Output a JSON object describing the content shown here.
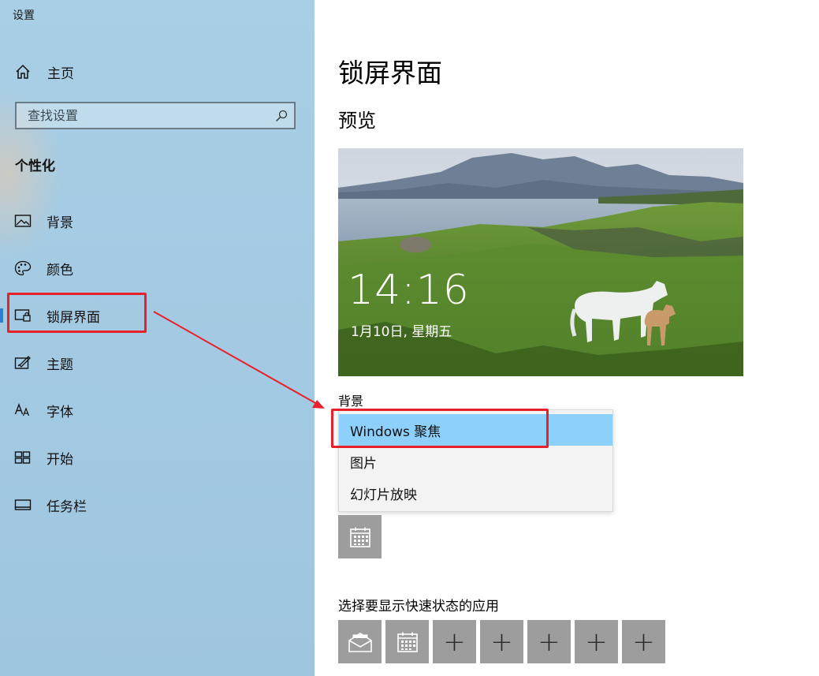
{
  "window": {
    "title": "设置"
  },
  "sidebar": {
    "home_label": "主页",
    "search_placeholder": "查找设置",
    "section_title": "个性化",
    "items": [
      {
        "label": "背景",
        "icon": "picture-icon"
      },
      {
        "label": "颜色",
        "icon": "palette-icon"
      },
      {
        "label": "锁屏界面",
        "icon": "lock-screen-icon",
        "active": true
      },
      {
        "label": "主题",
        "icon": "theme-icon"
      },
      {
        "label": "字体",
        "icon": "font-icon"
      },
      {
        "label": "开始",
        "icon": "start-icon"
      },
      {
        "label": "任务栏",
        "icon": "taskbar-icon"
      }
    ]
  },
  "main": {
    "title": "锁屏界面",
    "preview_title": "预览",
    "preview": {
      "time": "14:16",
      "date": "1月10日, 星期五"
    },
    "background_label": "背景",
    "background_options": [
      {
        "label": "Windows 聚焦",
        "selected": true
      },
      {
        "label": "图片"
      },
      {
        "label": "幻灯片放映"
      }
    ],
    "detailed_status_app_icon": "calendar-icon",
    "quick_status_label": "选择要显示快速状态的应用",
    "quick_status_apps": [
      "mail-icon",
      "calendar-icon",
      "plus-icon",
      "plus-icon",
      "plus-icon",
      "plus-icon",
      "plus-icon"
    ],
    "plus_symbol": "+"
  },
  "colors": {
    "accent": "#2a7fd0",
    "annotation_red": "#e8202a",
    "selected_option": "#8cd0fb",
    "tile_gray": "#9d9d9d"
  }
}
